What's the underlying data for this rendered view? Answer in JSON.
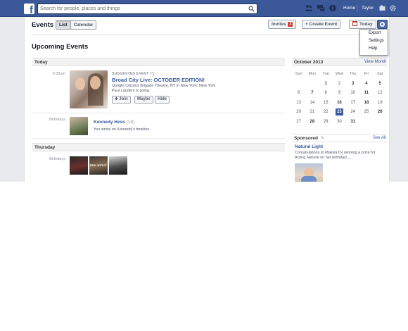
{
  "search": {
    "placeholder": "Search for people, places and things"
  },
  "topnav": {
    "home": "Home",
    "user": "Taylor"
  },
  "header": {
    "title": "Events",
    "view_list": "List",
    "view_calendar": "Calendar",
    "invites_label": "Invites",
    "invites_count": "2",
    "create_label": "+ Create Event",
    "today_label": "Today"
  },
  "gear_menu": {
    "items": [
      "Export",
      "Settings",
      "Help"
    ]
  },
  "section_title": "Upcoming Events",
  "days": {
    "today": "Today",
    "thursday": "Thursday"
  },
  "event": {
    "time": "9:30pm",
    "suggested_label": "SUGGESTED EVENT",
    "suggested_help": "[?]",
    "title": "Broad City Live: OCTOBER EDITION!",
    "location": "Upright Citizens Brigade Theatre, NY in New York, New York",
    "friends_going": "Paul Lauders is going.",
    "join": "Join",
    "maybe": "Maybe",
    "hide": "Hide"
  },
  "birthdays": {
    "label": "Birthdays",
    "today_name": "Kennedy Hess",
    "today_age": "(18)",
    "today_note": "You wrote on Kennedy's timeline.",
    "thursday_label": "Birthdays",
    "thursday_photo_caption": "REAL WITH IT"
  },
  "calendar": {
    "month": "October 2013",
    "view_month": "View Month",
    "dow": [
      "Sun",
      "Mon",
      "Tue",
      "Wed",
      "Thu",
      "Fri",
      "Sat"
    ],
    "weeks": [
      [
        "",
        "",
        "1",
        "2",
        "3",
        "4",
        "5"
      ],
      [
        "6",
        "7",
        "8",
        "9",
        "10",
        "11",
        "12"
      ],
      [
        "13",
        "14",
        "15",
        "16",
        "17",
        "18",
        "19"
      ],
      [
        "20",
        "21",
        "22",
        "23",
        "24",
        "25",
        "26"
      ],
      [
        "27",
        "28",
        "29",
        "30",
        "31",
        "",
        ""
      ]
    ],
    "bold_days": [
      "1",
      "3",
      "4",
      "5",
      "7",
      "11",
      "16",
      "18",
      "23",
      "26",
      "28",
      "31"
    ],
    "today": "23"
  },
  "sponsored": {
    "title": "Sponsored",
    "see_all": "See All",
    "ad_title": "Natural Light",
    "ad_text": "Conratulations to Makyla for winning a prize for Acting Natural on her birthday!...."
  },
  "colors": {
    "brand": "#3b5998",
    "badge": "#d33a2a",
    "link": "#3b5998"
  }
}
